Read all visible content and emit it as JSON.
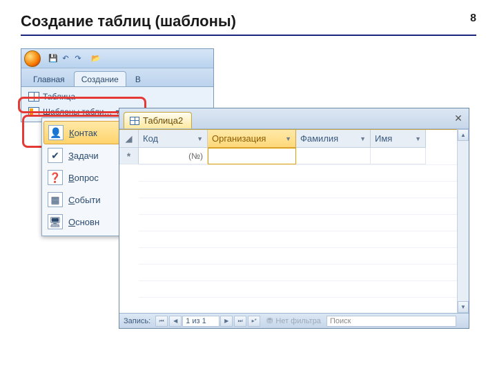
{
  "slide": {
    "title": "Создание таблиц (шаблоны)",
    "number": "8"
  },
  "ribbon": {
    "tabs": {
      "home": "Главная",
      "create": "Создание",
      "other": "В"
    },
    "buttons": {
      "table": "Таблица",
      "templates": "Шаблоны табли…",
      "templates_dd": "▾"
    }
  },
  "dropdown": {
    "contacts": "Контак",
    "tasks": "Задачи",
    "issues": "Вопрос",
    "events": "Событи",
    "assets": "Основн"
  },
  "sheet": {
    "tab": "Таблица2",
    "columns": {
      "id": "Код",
      "org": "Организация",
      "lastname": "Фамилия",
      "firstname": "Имя"
    },
    "newrow_id": "(№)",
    "nav": {
      "label": "Запись:",
      "pos": "1 из 1",
      "nofilter": "Нет фильтра",
      "search": "Поиск"
    }
  }
}
